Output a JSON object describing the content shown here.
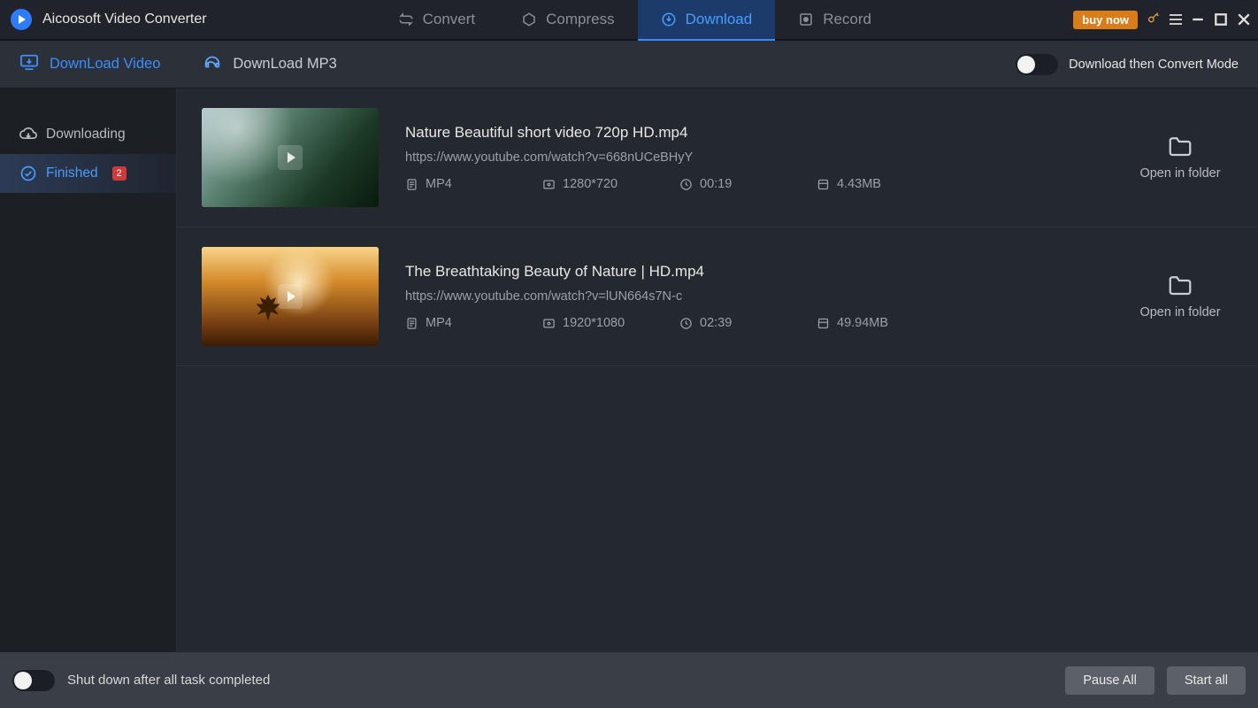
{
  "app": {
    "title": "Aicoosoft Video Converter"
  },
  "titlebar": {
    "tabs": [
      {
        "label": "Convert"
      },
      {
        "label": "Compress"
      },
      {
        "label": "Download"
      },
      {
        "label": "Record"
      }
    ],
    "buy_now": "buy now"
  },
  "subbar": {
    "download_video": "DownLoad Video",
    "download_mp3": "DownLoad MP3",
    "convert_mode_label": "Download then Convert Mode"
  },
  "sidebar": {
    "downloading": "Downloading",
    "finished": "Finished",
    "finished_count": "2"
  },
  "rows": [
    {
      "title": "Nature Beautiful short video 720p HD.mp4",
      "url": "https://www.youtube.com/watch?v=668nUCeBHyY",
      "format": "MP4",
      "resolution": "1280*720",
      "duration": "00:19",
      "size": "4.43MB",
      "open_label": "Open in folder"
    },
    {
      "title": "The Breathtaking Beauty of Nature | HD.mp4",
      "url": "https://www.youtube.com/watch?v=lUN664s7N-c",
      "format": "MP4",
      "resolution": "1920*1080",
      "duration": "02:39",
      "size": "49.94MB",
      "open_label": "Open in folder"
    }
  ],
  "footer": {
    "shutdown_label": "Shut down after all task completed",
    "pause_all": "Pause All",
    "start_all": "Start all"
  }
}
